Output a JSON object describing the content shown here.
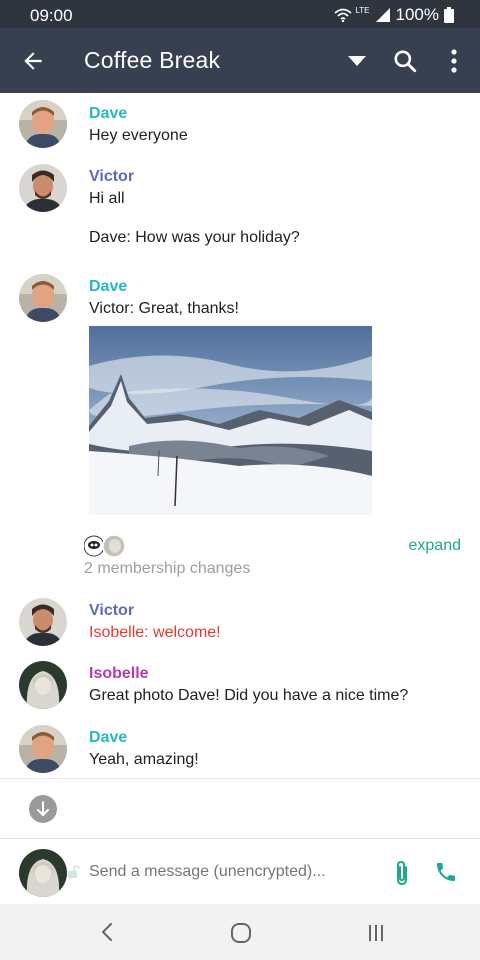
{
  "status_bar": {
    "time": "09:00",
    "network": "LTE",
    "battery": "100%"
  },
  "header": {
    "room_name": "Coffee Break"
  },
  "colors": {
    "dave": "#26b7c8",
    "victor": "#5c6bc0",
    "isobelle": "#b23cb5",
    "accent": "#1fa88e",
    "error": "#e53935"
  },
  "timeline": {
    "messages": [
      {
        "sender": "Dave",
        "text": "Hey everyone"
      },
      {
        "sender": "Victor",
        "text": "Hi all",
        "continued_text": "Dave: How was your holiday?"
      },
      {
        "sender": "Dave",
        "text": "Victor: Great, thanks!"
      },
      {
        "sender": "Victor",
        "text": "Isobelle: welcome!"
      },
      {
        "sender": "Isobelle",
        "text": "Great photo Dave! Did you have a nice time?"
      },
      {
        "sender": "Dave",
        "text": "Yeah, amazing!"
      }
    ],
    "membership": {
      "summary": "2 membership changes",
      "expand_label": "expand"
    }
  },
  "composer": {
    "placeholder": "Send a message (unencrypted)..."
  },
  "icons": {
    "back": "arrow-back-icon",
    "dropdown": "dropdown-icon",
    "search": "search-icon",
    "more": "more-vert-icon",
    "attach": "paperclip-icon",
    "call": "phone-icon",
    "jump": "arrow-down-icon"
  }
}
